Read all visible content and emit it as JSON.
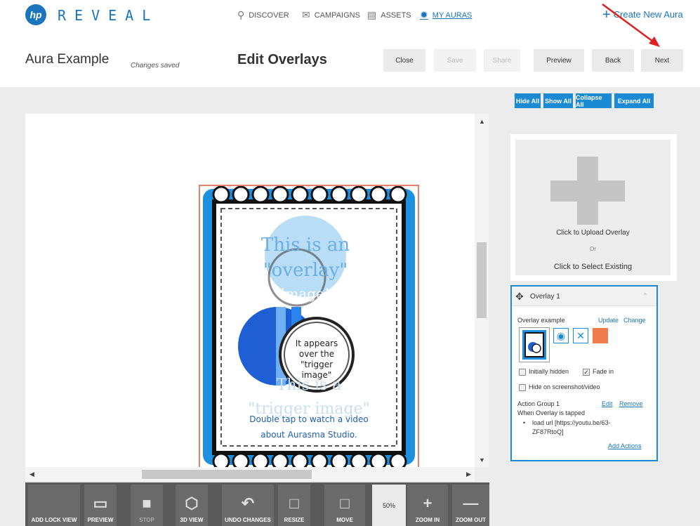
{
  "nav": {
    "logo": "hp",
    "brand": "REVEAL",
    "items": [
      {
        "label": "DISCOVER",
        "icon": "search-icon"
      },
      {
        "label": "CAMPAIGNS",
        "icon": "megaphone-icon"
      },
      {
        "label": "ASSETS",
        "icon": "image-icon"
      },
      {
        "label": "MY AURAS",
        "icon": "aura-icon"
      }
    ],
    "create_label": "Create New Aura"
  },
  "header": {
    "aura_name": "Aura Example",
    "status": "Changes saved",
    "page_title": "Edit Overlays",
    "buttons": {
      "close": "Close",
      "save": "Save",
      "share": "Share",
      "preview": "Preview",
      "back": "Back",
      "next": "Next"
    }
  },
  "view_buttons": {
    "hide_all": "Hide All",
    "show_all": "Show All",
    "collapse_all": "Collapse All",
    "expand_all": "Expand All"
  },
  "artwork": {
    "line1": "This is an",
    "line2": "\"overlay\"",
    "line3": "image!",
    "bubble": [
      "It appears",
      "over the",
      "\"trigger",
      "image\""
    ],
    "ghost1": "This is a",
    "ghost2": "\"trigger image\"",
    "line4": "Double tap to watch a video",
    "line5": "about Aurasma Studio."
  },
  "toolbar": {
    "add_lock_view": "ADD LOCK VIEW",
    "preview": "PREVIEW",
    "stop": "STOP",
    "view_3d": "3D VIEW",
    "undo": "UNDO CHANGES",
    "resize": "RESIZE",
    "move": "MOVE",
    "zoom_level": "50%",
    "zoom_in": "ZOOM IN",
    "zoom_out": "ZOOM OUT"
  },
  "upload": {
    "upload_label": "Click to Upload Overlay",
    "or": "Or",
    "select_label": "Click to Select Existing"
  },
  "overlay": {
    "title": "Overlay 1",
    "name": "Overlay example",
    "update": "Update",
    "change": "Change",
    "initially_hidden": "Initially hidden",
    "fade_in": "Fade in",
    "hide_on_screenshot": "Hide on screenshot/video",
    "action_group": "Action Group 1",
    "edit": "Edit",
    "remove": "Remove",
    "trigger": "When Overlay is tapped",
    "action_line1": "load url [https://youtu.be/63-",
    "action_line2": "ZF87RtoQ]",
    "add_actions": "Add Actions",
    "accent_color": "#f07b4c"
  }
}
